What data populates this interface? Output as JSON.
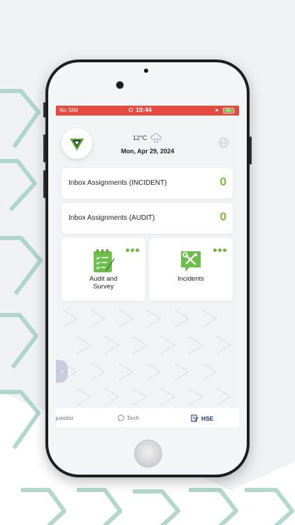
{
  "status_bar": {
    "carrier": "No SIM",
    "time": "10:44"
  },
  "header": {
    "temperature": "12°C",
    "date": "Mon, Apr 29, 2024"
  },
  "inbox": [
    {
      "label": "Inbox Assignments (INCIDENT)",
      "count": "0"
    },
    {
      "label": "Inbox Assignments (AUDIT)",
      "count": "0"
    }
  ],
  "tiles": [
    {
      "label_line1": "Audit and",
      "label_line2": "Survey"
    },
    {
      "label_line1": "Incidents",
      "label_line2": ""
    }
  ],
  "tabs": [
    {
      "label": "questor"
    },
    {
      "label": "Tech"
    },
    {
      "label": "HSE"
    }
  ],
  "colors": {
    "status_bar": "#e8493f",
    "accent_green": "#7dbb3d",
    "active_tab": "#1c2f75"
  }
}
